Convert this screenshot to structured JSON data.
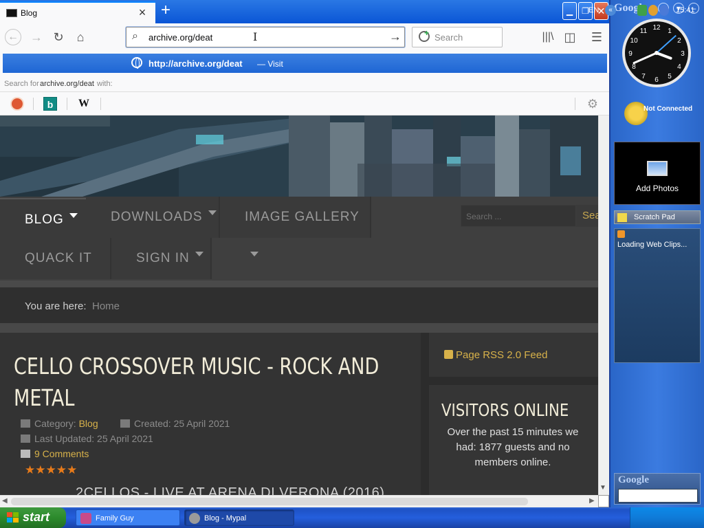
{
  "browser": {
    "tab": {
      "title": "Blog",
      "close": "×"
    },
    "new_tab": "+",
    "window_controls": {
      "minimize": "▁",
      "maximize": "❐",
      "close": "✕"
    },
    "nav": {
      "back": "←",
      "forward": "→",
      "reload": "↻",
      "home": "⌂",
      "library": "|||\\",
      "sidebar": "◫",
      "menu": "☰"
    },
    "urlbar": {
      "value": "archive.org/deat",
      "go": "→"
    },
    "searchbox": {
      "placeholder": "Search"
    },
    "suggestion": {
      "url": "http://archive.org/deat",
      "action": "— Visit"
    },
    "search_for": {
      "prefix": "Search for",
      "query": "archive.org/deat",
      "suffix": "with:"
    },
    "engines": [
      {
        "name": "DuckDuckGo",
        "icon": "duckduckgo-icon"
      },
      {
        "name": "Bing",
        "icon": "bing-icon",
        "glyph": "b"
      },
      {
        "name": "Wikipedia",
        "icon": "wikipedia-icon",
        "glyph": "W"
      }
    ],
    "engine_settings": "⚙"
  },
  "site": {
    "menu": [
      {
        "label": "BLOG",
        "active": true,
        "dropdown": true
      },
      {
        "label": "DOWNLOADS",
        "active": false,
        "dropdown": true
      },
      {
        "label": "IMAGE GALLERY",
        "active": false,
        "dropdown": true
      },
      {
        "label": "QUACK IT",
        "active": false,
        "dropdown": false
      },
      {
        "label": "SIGN IN",
        "active": false,
        "dropdown": true
      }
    ],
    "search": {
      "placeholder": "Search ...",
      "button": "Sea"
    },
    "breadcrumb": {
      "label": "You are here:",
      "home": "Home"
    },
    "article": {
      "title": "CELLO CROSSOVER MUSIC - ROCK AND METAL",
      "category_label": "Category:",
      "category": "Blog",
      "created": "Created: 25 April 2021",
      "updated": "Last Updated: 25 April 2021",
      "comments": "9 Comments",
      "rating": "★★★★★",
      "rating_value": 5,
      "rating_max": 5,
      "subheading": "2CELLOS - LIVE AT ARENA DI VERONA (2016)"
    },
    "sidebar": {
      "rss": "Page RSS 2.0 Feed",
      "visitors_title": "VISITORS ONLINE",
      "visitors_text": "Over the past 15 minutes we had: 1877 guests and no members online."
    }
  },
  "google_sidebar": {
    "logo": "Google",
    "controls": {
      "add": "+",
      "menu": "▾",
      "minimize": "–"
    },
    "clock": {
      "numbers": [
        "12",
        "1",
        "2",
        "3",
        "4",
        "5",
        "6",
        "7",
        "8",
        "9",
        "10",
        "11"
      ],
      "hour": 3,
      "minute": 41,
      "second": 8
    },
    "weather": {
      "status": "Not Connected"
    },
    "photos": {
      "label": "Add Photos"
    },
    "scratchpad": {
      "label": "Scratch Pad"
    },
    "webclips": {
      "label": "Loading Web Clips..."
    },
    "search_logo": "Google"
  },
  "taskbar": {
    "start": "start",
    "tasks": [
      {
        "label": "Family Guy"
      },
      {
        "label": "Blog - Mypal"
      }
    ],
    "language": "EN",
    "expand": "«",
    "time": "15:41"
  },
  "colors": {
    "accent_gold": "#d8b24a",
    "page_bg": "#2c2c2c",
    "xp_blue": "#245edc",
    "start_green": "#2c8a2c",
    "suggestion_blue": "#2a6fd6"
  }
}
